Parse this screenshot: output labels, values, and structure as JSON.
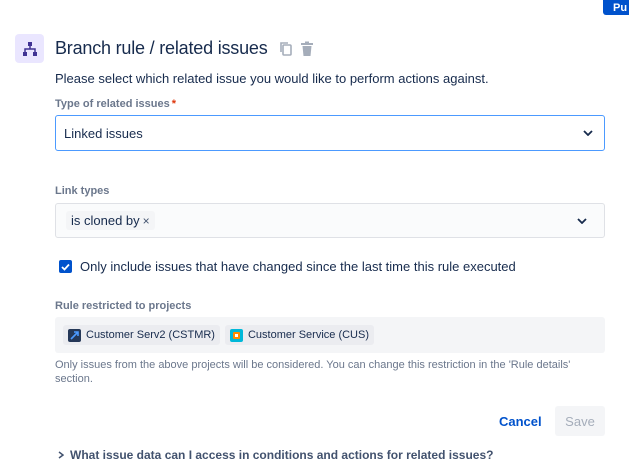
{
  "top_button": {
    "label": "Pu"
  },
  "header": {
    "title": "Branch rule / related issues",
    "icon": "branch-icon",
    "actions": [
      "copy-icon",
      "trash-icon"
    ]
  },
  "description": "Please select which related issue you would like to perform actions against.",
  "related_type": {
    "label": "Type of related issues",
    "required_mark": "*",
    "value": "Linked issues"
  },
  "link_types": {
    "label": "Link types",
    "chips": [
      {
        "label": "is cloned by",
        "remove": "×"
      }
    ]
  },
  "only_changed": {
    "checked": true,
    "label": "Only include issues that have changed since the last time this rule executed"
  },
  "restricted": {
    "label": "Rule restricted to projects",
    "projects": [
      {
        "label": "Customer Serv2 (CSTMR)",
        "icon": "rocket-project-icon"
      },
      {
        "label": "Customer Service (CUS)",
        "icon": "project-icon"
      }
    ],
    "helper": "Only issues from the above projects will be considered. You can change this restriction in the 'Rule details' section."
  },
  "actions": {
    "cancel": "Cancel",
    "save": "Save"
  },
  "expander": {
    "label": "What issue data can I access in conditions and actions for related issues?"
  },
  "colors": {
    "primary": "#0052cc",
    "focus_border": "#4c9aff",
    "required": "#de350b",
    "icon_bg": "#eae6ff"
  }
}
